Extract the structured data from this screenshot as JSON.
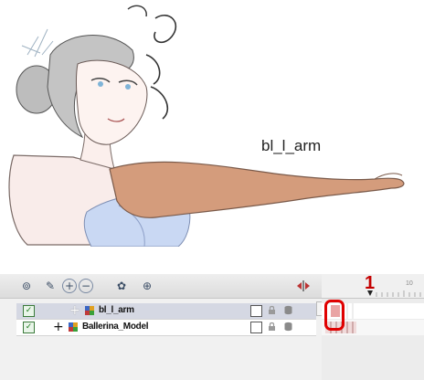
{
  "artwork": {
    "arm_label": "bl_l_arm"
  },
  "toolbar": {
    "buttons": [
      {
        "icon": "onion-skin-icon",
        "glyph": "⊚"
      },
      {
        "icon": "layer-properties-icon",
        "glyph": "✎"
      },
      {
        "icon": "add-layer-icon",
        "glyph": "+"
      },
      {
        "icon": "delete-layer-icon",
        "glyph": "−"
      },
      {
        "icon": "add-drawing-layer-icon",
        "glyph": "✿"
      },
      {
        "icon": "add-peg-icon",
        "glyph": "⊕"
      }
    ],
    "divider_icon": "collapse-expand-icon"
  },
  "layers": [
    {
      "name": "bl_l_arm",
      "checked": true,
      "expander": "+",
      "selected": true
    },
    {
      "name": "Ballerina_Model",
      "checked": true,
      "expander": "+",
      "selected": false
    }
  ],
  "timeline": {
    "current_frame": "1",
    "tick_label": "10"
  },
  "colors": {
    "selected_row": "#d5d8e3",
    "highlight": "#e00000",
    "frame_marker": "#c40000",
    "keyframe_cell": "#e9a4a4"
  }
}
